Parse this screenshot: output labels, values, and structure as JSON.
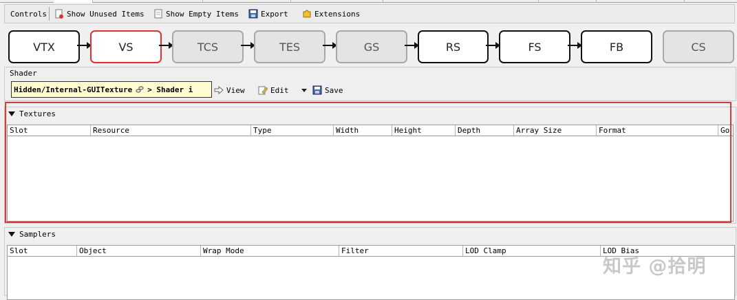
{
  "toolbar": {
    "controls_label": "Controls",
    "show_unused_label": "Show Unused Items",
    "show_empty_label": "Show Empty Items",
    "export_label": "Export",
    "extensions_label": "Extensions"
  },
  "pipeline": {
    "stages": [
      {
        "label": "VTX",
        "state": "active"
      },
      {
        "label": "VS",
        "state": "selected"
      },
      {
        "label": "TCS",
        "state": "inactive"
      },
      {
        "label": "TES",
        "state": "inactive"
      },
      {
        "label": "GS",
        "state": "inactive"
      },
      {
        "label": "RS",
        "state": "active"
      },
      {
        "label": "FS",
        "state": "active"
      },
      {
        "label": "FB",
        "state": "active"
      },
      {
        "label": "CS",
        "state": "inactive"
      }
    ]
  },
  "shader": {
    "section_label": "Shader",
    "path_text": "Hidden/Internal-GUITexture",
    "path_suffix": "> Shader i",
    "view_label": "View",
    "edit_label": "Edit",
    "save_label": "Save"
  },
  "textures": {
    "title": "Textures",
    "columns": [
      "Slot",
      "Resource",
      "Type",
      "Width",
      "Height",
      "Depth",
      "Array Size",
      "Format",
      "Go"
    ],
    "rows": []
  },
  "samplers": {
    "title": "Samplers",
    "columns": [
      "Slot",
      "Object",
      "Wrap Mode",
      "Filter",
      "LOD Clamp",
      "LOD Bias"
    ],
    "rows": []
  },
  "watermark": "知乎 @拾明",
  "colors": {
    "selected_border": "#e03030",
    "highlight_box": "#d83a3a",
    "path_background": "#fffbd0"
  }
}
